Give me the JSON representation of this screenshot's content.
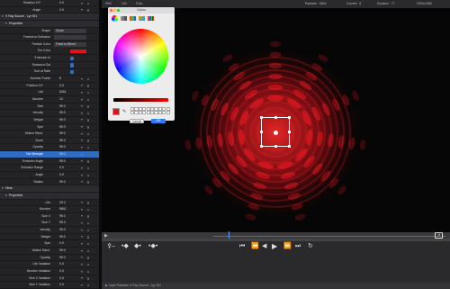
{
  "inspector": {
    "rows": [
      {
        "label": "Rotation X/Y",
        "value": "0.0",
        "kind": "param",
        "indent": 15
      },
      {
        "label": "Angle",
        "value": "0.0",
        "kind": "param",
        "indent": 15
      },
      {
        "label": "X Ray Source - Lyr 001",
        "value": "",
        "kind": "head",
        "indent": 6
      },
      {
        "label": "Properties",
        "value": "",
        "kind": "head",
        "indent": 10
      },
      {
        "label": "Shape",
        "value": "Circle",
        "kind": "popup",
        "indent": 26
      },
      {
        "label": "Frames to Emission",
        "value": "",
        "kind": "popup",
        "indent": 26
      },
      {
        "label": "Particle Color",
        "value": "Fixed to Blend",
        "kind": "popup",
        "indent": 26
      },
      {
        "label": "Tint Color",
        "value": "",
        "kind": "color",
        "indent": 26
      },
      {
        "label": "Emission In",
        "value": "",
        "kind": "check",
        "indent": 26
      },
      {
        "label": "Emission Out",
        "value": "",
        "kind": "check",
        "indent": 26
      },
      {
        "label": "Sort at Rate",
        "value": "",
        "kind": "check",
        "indent": 26
      },
      {
        "label": "Number Points",
        "value": "8",
        "kind": "param",
        "indent": 26
      },
      {
        "label": "Position X/Y",
        "value": "0.0",
        "kind": "param",
        "indent": 18
      },
      {
        "label": "Life",
        "value": "6261",
        "kind": "param",
        "indent": 18
      },
      {
        "label": "Number",
        "value": "13",
        "kind": "param",
        "indent": 18
      },
      {
        "label": "Size",
        "value": "99.0",
        "kind": "param",
        "indent": 18
      },
      {
        "label": "Velocity",
        "value": "99.0",
        "kind": "param",
        "indent": 18
      },
      {
        "label": "Weight",
        "value": "99.0",
        "kind": "param",
        "indent": 18
      },
      {
        "label": "Spin",
        "value": "99.0",
        "kind": "param",
        "indent": 18
      },
      {
        "label": "Motion Rand.",
        "value": "99.0",
        "kind": "param",
        "indent": 18
      },
      {
        "label": "Zoom",
        "value": "99.0",
        "kind": "param",
        "indent": 18
      },
      {
        "label": "Opacity",
        "value": "99.0",
        "kind": "param",
        "indent": 18
      },
      {
        "label": "Tint Strength",
        "value": "99.0",
        "kind": "sel",
        "indent": 18
      },
      {
        "label": "Emission Angle",
        "value": "99.0",
        "kind": "param",
        "indent": 18
      },
      {
        "label": "Emission Range",
        "value": "0.0",
        "kind": "param",
        "indent": 18
      },
      {
        "label": "Angle",
        "value": "0.0",
        "kind": "param",
        "indent": 18
      },
      {
        "label": "Radius",
        "value": "99.0",
        "kind": "param",
        "indent": 18
      },
      {
        "label": "Hints",
        "value": "",
        "kind": "head",
        "indent": 6
      },
      {
        "label": "Properties",
        "value": "",
        "kind": "head",
        "indent": 10
      },
      {
        "label": "Life",
        "value": "23.3",
        "kind": "param",
        "indent": 26
      },
      {
        "label": "Number",
        "value": "9842",
        "kind": "param",
        "indent": 26
      },
      {
        "label": "Size X",
        "value": "99.0",
        "kind": "param",
        "indent": 26
      },
      {
        "label": "Size Y",
        "value": "99.0",
        "kind": "param",
        "indent": 26
      },
      {
        "label": "Velocity",
        "value": "99.0",
        "kind": "param",
        "indent": 26
      },
      {
        "label": "Weight",
        "value": "99.0",
        "kind": "param",
        "indent": 26
      },
      {
        "label": "Spin",
        "value": "0.0",
        "kind": "param",
        "indent": 26
      },
      {
        "label": "Motion Rand.",
        "value": "99.0",
        "kind": "param",
        "indent": 26
      },
      {
        "label": "Opacity",
        "value": "99.0",
        "kind": "param",
        "indent": 26
      },
      {
        "label": "Life Variation",
        "value": "0.0",
        "kind": "param",
        "indent": 26
      },
      {
        "label": "Number Variation",
        "value": "0.0",
        "kind": "param",
        "indent": 26
      },
      {
        "label": "Size X Variation",
        "value": "0.0",
        "kind": "param",
        "indent": 26
      },
      {
        "label": "Size Y Variation",
        "value": "0.0",
        "kind": "param",
        "indent": 26
      }
    ]
  },
  "viewer": {
    "top_left_a": "99%",
    "top_left_b": "100",
    "top_left_c": "FULL",
    "top_right_a": "Particles · 9842",
    "top_right_b": "Current · 6",
    "top_right_c": "Duration · 77",
    "top_right_d": "1920x1080"
  },
  "color_panel": {
    "title": "Colors",
    "cancel_label": "Cancel",
    "ok_label": "OK"
  },
  "transport": {
    "icons": [
      "key-icon",
      "keyframe-prev-icon",
      "keyframe-next-icon",
      "play-icon",
      "loop-icon",
      "rewind-icon",
      "step-back-icon",
      "play-icon",
      "step-forward-icon",
      "forward-icon"
    ]
  },
  "status": {
    "layer_label": "Layer Particles X Ray Source - Lyr 001"
  },
  "colors": {
    "accent": "#2f6cc2",
    "tint": "#e3101a",
    "particle": "#ff1a22"
  }
}
